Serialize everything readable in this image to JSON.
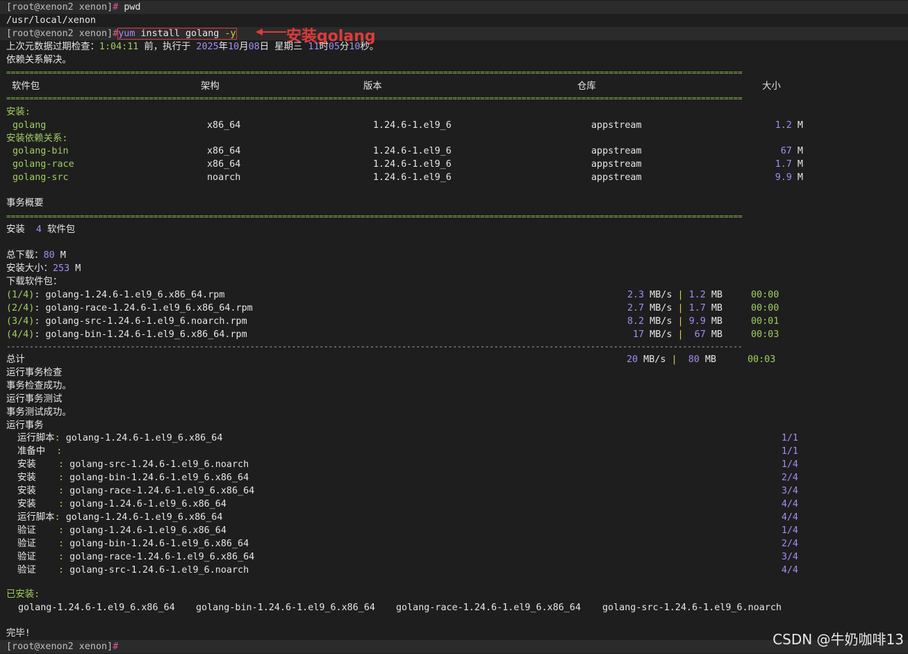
{
  "prompt": {
    "user": "[root@xenon2 xenon]",
    "hash": "#"
  },
  "l1_cmd": "pwd",
  "l2_out": "/usr/local/xenon",
  "l3": {
    "cmd": "yum",
    "args": " install golang",
    "flag": "-y"
  },
  "annotation": "安装golang",
  "meta": {
    "p1": "上次元数据过期检查：",
    "elapsed": "1:04:11",
    "p2": " 前，执行于 ",
    "year": "2025",
    "y_c": "年",
    "month": "10",
    "m_c": "月",
    "day": "08",
    "d_c": "日 星期三 ",
    "hour": "11",
    "h_c": "时",
    "min": "05",
    "mi_c": "分",
    "sec": "10",
    "s_c": "秒。"
  },
  "resolved": "依赖关系解决。",
  "headers": {
    "pkg": "软件包",
    "arch": "架构",
    "ver": "版本",
    "repo": "仓库",
    "size": "大小"
  },
  "section_install": "安装:",
  "section_deps": "安装依赖关系:",
  "packages": [
    {
      "name": "golang",
      "arch": "x86_64",
      "v1": "1.24.6",
      "v2": "-1.el9_6",
      "repo": "appstream",
      "size": "1.2",
      "unit": " M"
    },
    {
      "name": "golang-bin",
      "arch": "x86_64",
      "v1": "1.24.6",
      "v2": "-1.el9_6",
      "repo": "appstream",
      "size": "67",
      "unit": " M"
    },
    {
      "name": "golang-race",
      "arch": "x86_64",
      "v1": "1.24.6",
      "v2": "-1.el9_6",
      "repo": "appstream",
      "size": "1.7",
      "unit": " M"
    },
    {
      "name": "golang-src",
      "arch": "noarch",
      "v1": "1.24.6",
      "v2": "-1.el9_6",
      "repo": "appstream",
      "size": "9.9",
      "unit": " M"
    }
  ],
  "summary_title": "事务概要",
  "install_summary": {
    "label": "安装  ",
    "count": "4",
    "suffix": " 软件包"
  },
  "total_download": {
    "label": "总下载：",
    "value": "80",
    "unit": " M"
  },
  "installed_size": {
    "label": "安装大小：",
    "value": "253",
    "unit": " M"
  },
  "downloading": "下载软件包：",
  "downloads": [
    {
      "idx": "(1/4)",
      "file": ": golang-1.24.6-1.el9_6.x86_64.rpm",
      "rate": "2.3",
      "size": "1.2",
      "time": "00:00"
    },
    {
      "idx": "(2/4)",
      "file": ": golang-race-1.24.6-1.el9_6.x86_64.rpm",
      "rate": "2.7",
      "size": "1.7",
      "time": "00:00"
    },
    {
      "idx": "(3/4)",
      "file": ": golang-src-1.24.6-1.el9_6.noarch.rpm",
      "rate": "8.2",
      "size": "9.9",
      "time": "00:01"
    },
    {
      "idx": "(4/4)",
      "file": ": golang-bin-1.24.6-1.el9_6.x86_64.rpm",
      "rate": " 17",
      "size": " 67",
      "time": "00:03"
    }
  ],
  "rate_unit": " MB/s ",
  "bar": "|",
  "mb_unit": " MB",
  "total": {
    "label": "总计",
    "rate": "20",
    "size": "80",
    "time": "00:03"
  },
  "txn_lines": [
    "运行事务检查",
    "事务检查成功。",
    "运行事务测试",
    "事务测试成功。",
    "运行事务"
  ],
  "steps": [
    {
      "label": "运行脚本",
      "colon": ": ",
      "pkg": "golang-1.24.6-1.el9_6.x86_64",
      "cnt": "1/1"
    },
    {
      "label": "准备中  ",
      "colon": ": ",
      "pkg": "",
      "cnt": "1/1"
    },
    {
      "label": "安装    ",
      "colon": ": ",
      "pkg": "golang-src-1.24.6-1.el9_6.noarch",
      "cnt": "1/4"
    },
    {
      "label": "安装    ",
      "colon": ": ",
      "pkg": "golang-bin-1.24.6-1.el9_6.x86_64",
      "cnt": "2/4"
    },
    {
      "label": "安装    ",
      "colon": ": ",
      "pkg": "golang-race-1.24.6-1.el9_6.x86_64",
      "cnt": "3/4"
    },
    {
      "label": "安装    ",
      "colon": ": ",
      "pkg": "golang-1.24.6-1.el9_6.x86_64",
      "cnt": "4/4"
    },
    {
      "label": "运行脚本",
      "colon": ": ",
      "pkg": "golang-1.24.6-1.el9_6.x86_64",
      "cnt": "4/4"
    },
    {
      "label": "验证    ",
      "colon": ": ",
      "pkg": "golang-1.24.6-1.el9_6.x86_64",
      "cnt": "1/4"
    },
    {
      "label": "验证    ",
      "colon": ": ",
      "pkg": "golang-bin-1.24.6-1.el9_6.x86_64",
      "cnt": "2/4"
    },
    {
      "label": "验证    ",
      "colon": ": ",
      "pkg": "golang-race-1.24.6-1.el9_6.x86_64",
      "cnt": "3/4"
    },
    {
      "label": "验证    ",
      "colon": ": ",
      "pkg": "golang-src-1.24.6-1.el9_6.noarch",
      "cnt": "4/4"
    }
  ],
  "installed_title": "已安装:",
  "installed": [
    "golang-1.24.6-1.el9_6.x86_64",
    "golang-bin-1.24.6-1.el9_6.x86_64",
    "golang-race-1.24.6-1.el9_6.x86_64",
    "golang-src-1.24.6-1.el9_6.noarch"
  ],
  "done": "完毕!",
  "watermark": "CSDN @牛奶咖啡13"
}
